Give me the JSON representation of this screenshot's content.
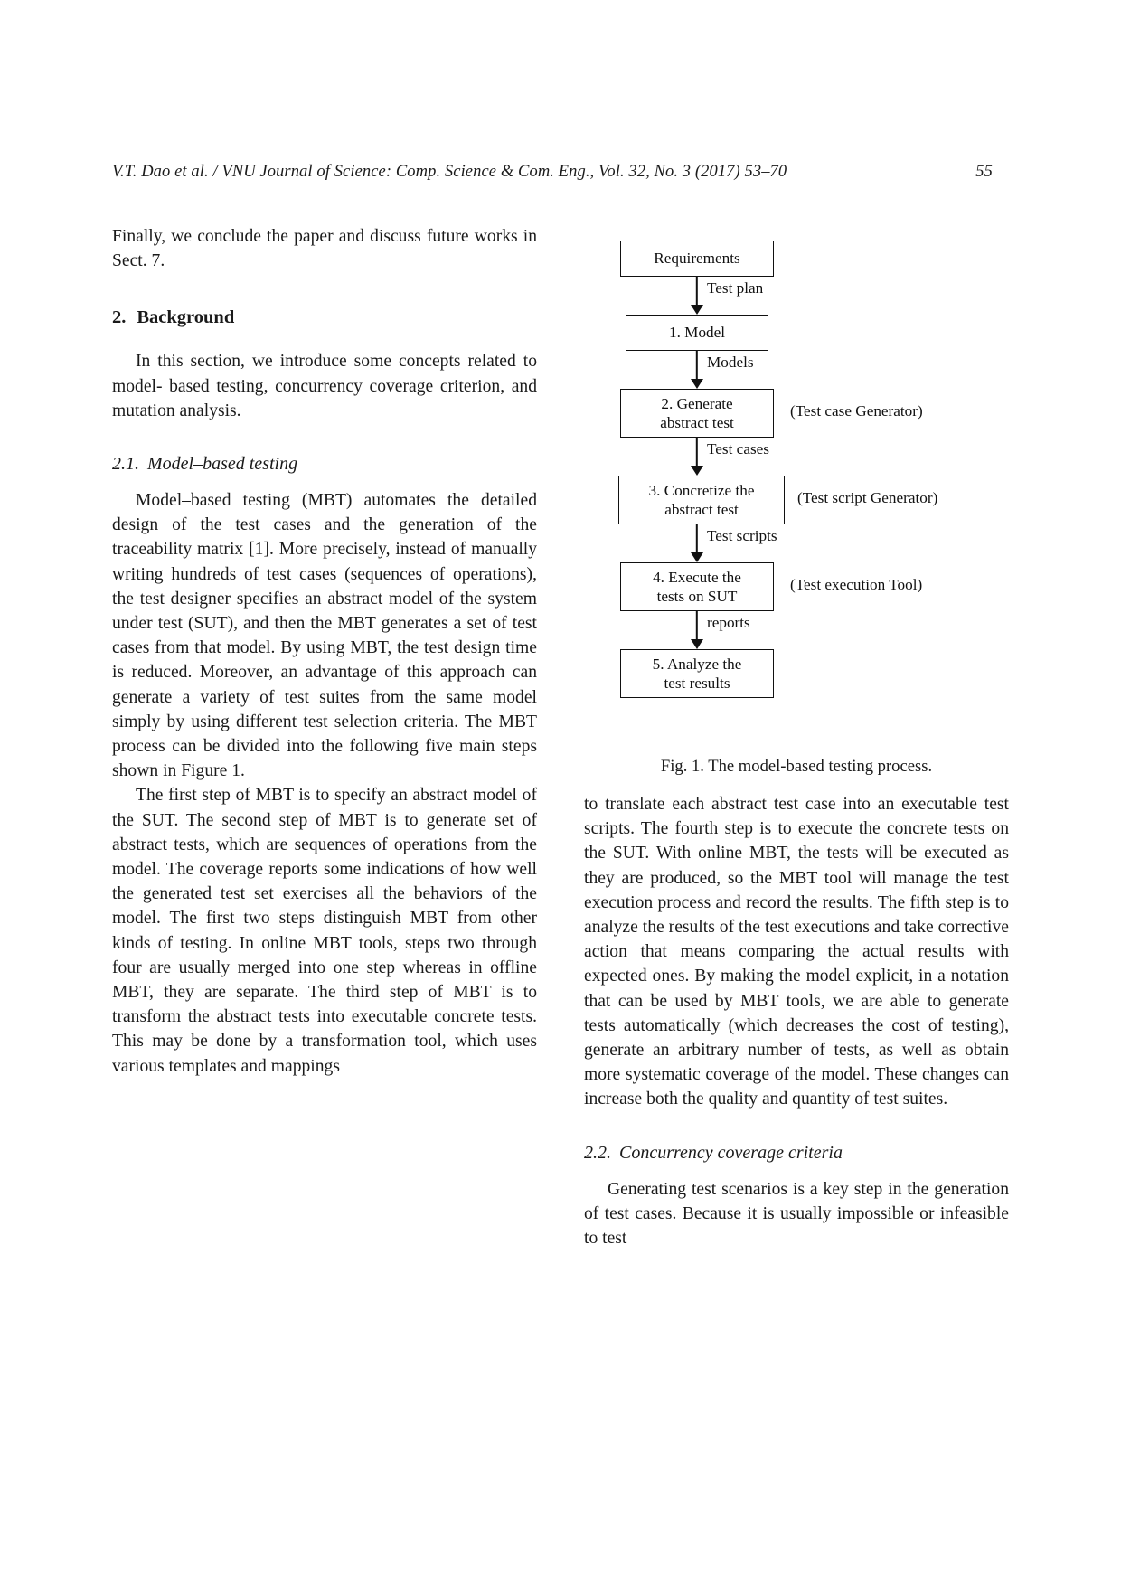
{
  "running_head": {
    "text": "V.T. Dao et al. / VNU Journal of Science: Comp. Science & Com. Eng., Vol. 32, No. 3 (2017) 53–70",
    "page_number": "55"
  },
  "left_column": {
    "intro_paragraph": "Finally, we conclude the paper and discuss future works in Sect. 7.",
    "section_2": {
      "number": "2.",
      "title": "Background",
      "paragraph": "In this section, we introduce some concepts related to model- based testing, concurrency coverage criterion, and mutation analysis."
    },
    "subsection_2_1": {
      "number": "2.1.",
      "title": "Model–based testing",
      "paragraph_1": "Model–based testing (MBT) automates the detailed design of the test cases and the generation of the traceability matrix [1].  More precisely, instead of manually writing hundreds of test cases (sequences of operations), the test designer specifies an abstract model of the system under test (SUT), and then the MBT generates a set of test cases from that model.  By using MBT, the test design time is reduced.  Moreover, an advantage of this approach can generate a variety of test suites from the same model simply by using different test selection criteria.  The MBT process can be divided into the following five main steps shown in Figure 1.",
      "paragraph_2": "The first step of MBT is to specify an abstract model of the SUT. The second step of MBT is to generate set of abstract tests, which are sequences of operations from the model. The coverage reports some indications of how well the generated test set exercises all the behaviors of the model.  The first two steps distinguish MBT from other kinds of testing.  In online MBT tools, steps two through four are usually merged into one step whereas in offline MBT, they are separate. The third step of MBT is to transform the abstract tests into executable concrete tests. This may be done by a transformation tool, which uses various templates and mappings"
    }
  },
  "figure": {
    "caption": "Fig. 1. The model-based testing process.",
    "nodes": [
      {
        "id": "requirements",
        "lines": [
          "Requirements"
        ]
      },
      {
        "id": "model",
        "lines": [
          "1. Model"
        ]
      },
      {
        "id": "generate-abstract-test",
        "lines": [
          "2. Generate",
          "abstract test"
        ]
      },
      {
        "id": "concretize-abstract-test",
        "lines": [
          "3. Concretize the",
          "abstract test"
        ]
      },
      {
        "id": "execute-tests-on-sut",
        "lines": [
          "4. Execute the",
          "tests on SUT"
        ]
      },
      {
        "id": "analyze-test-results",
        "lines": [
          "5. Analyze the",
          "test results"
        ]
      }
    ],
    "edge_labels": [
      {
        "id": "test-plan",
        "text": "Test plan"
      },
      {
        "id": "models",
        "text": "Models"
      },
      {
        "id": "test-cases",
        "text": "Test cases"
      },
      {
        "id": "test-scripts",
        "text": "Test scripts"
      },
      {
        "id": "reports",
        "text": "reports"
      }
    ],
    "side_labels": [
      {
        "id": "test-case-generator",
        "text": "(Test case Generator)"
      },
      {
        "id": "test-script-generator",
        "text": "(Test script Generator)"
      },
      {
        "id": "test-execution-tool",
        "text": "(Test execution Tool)"
      }
    ]
  },
  "right_column": {
    "paragraph_1": "to translate each abstract test case into an executable test scripts.  The fourth step is to execute the concrete tests on the SUT. With online MBT, the tests will be executed as they are produced, so the MBT tool will manage the test execution process and record the results.   The fifth step is to analyze the results of the test executions and take corrective action that means comparing the actual results with expected ones. By making the model explicit, in a notation that can be used by MBT tools, we are able to generate tests automatically (which decreases the cost of testing), generate an arbitrary number of tests, as well as obtain more systematic coverage of the model.  These changes can increase both the quality and quantity of test suites.",
    "subsection_2_2": {
      "number": "2.2.",
      "title": "Concurrency coverage criteria",
      "paragraph": "Generating test scenarios is a key step in the generation of test cases.   Because it is usually impossible or infeasible to test"
    }
  }
}
